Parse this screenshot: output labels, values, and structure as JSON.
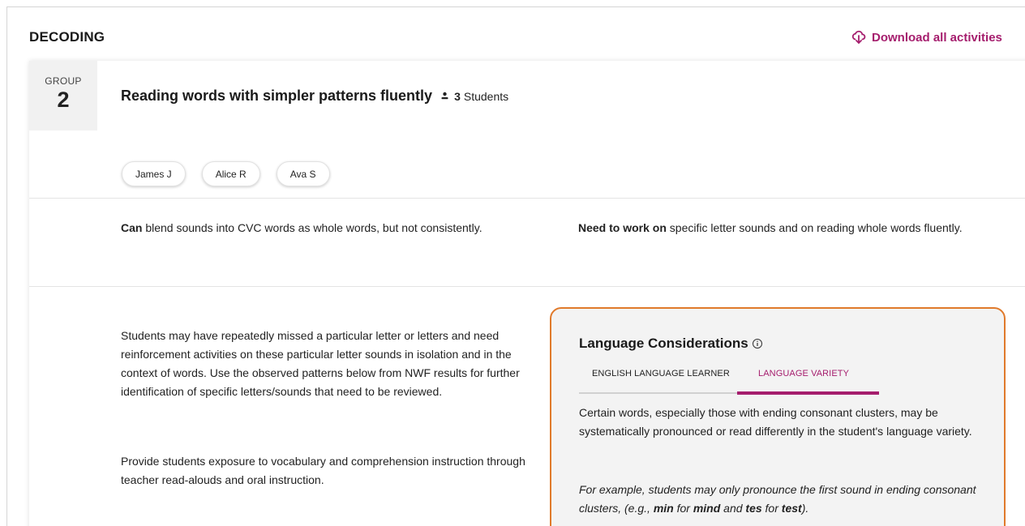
{
  "section": {
    "title": "DECODING",
    "download_label": "Download all activities"
  },
  "group": {
    "label": "GROUP",
    "number": "2",
    "title": "Reading words with simpler patterns fluently",
    "student_count": "3",
    "students_label": "Students"
  },
  "students": [
    {
      "name": "James J"
    },
    {
      "name": "Alice R"
    },
    {
      "name": "Ava S"
    }
  ],
  "can": {
    "lead": "Can",
    "text": " blend sounds into CVC words as whole words, but not consistently."
  },
  "need": {
    "lead": "Need to work on",
    "text": " specific letter sounds and on reading whole words fluently."
  },
  "guidance": {
    "paragraph1": "Students may have repeatedly missed a particular letter or letters and need reinforcement activities on these particular letter sounds in isolation and in the context of words. Use the observed patterns below from NWF results for further identification of specific letters/sounds that need to be reviewed.",
    "paragraph2": "Provide students exposure to vocabulary and comprehension instruction through teacher read-alouds and oral instruction."
  },
  "language": {
    "title": "Language Considerations",
    "tabs": [
      {
        "label": "ENGLISH LANGUAGE LEARNER",
        "active": false
      },
      {
        "label": "LANGUAGE VARIETY",
        "active": true
      }
    ],
    "text": "Certain words, especially those with ending consonant clusters, may be systematically pronounced or read differently in the student's language variety.",
    "example": {
      "intro": "For example, students may only pronounce the first sound in ending consonant clusters, (e.g., ",
      "w1": "min",
      "for1": " for ",
      "w2": "mind",
      "and": " and ",
      "w3": "tes",
      "for2": " for ",
      "w4": "test",
      "end": ")."
    }
  },
  "colors": {
    "accent": "#a51d6d",
    "highlight_border": "#e07a2b"
  },
  "icons": {
    "download": "download-cloud-icon",
    "students": "person-icon",
    "info": "info-icon"
  }
}
